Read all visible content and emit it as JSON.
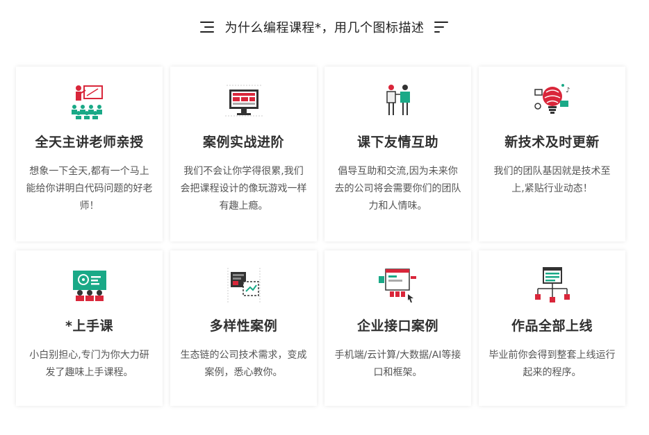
{
  "header": {
    "title": "为什么编程课程*，用几个图标描述"
  },
  "colors": {
    "accent_red": "#d9263a",
    "accent_teal": "#1aa987",
    "dark": "#333333"
  },
  "cards": [
    {
      "icon": "teacher-presentation-icon",
      "title": "全天主讲老师亲授",
      "desc": "想象一下全天,都有一个马上能给你讲明白代码问题的好老师！"
    },
    {
      "icon": "monitor-project-icon",
      "title": "案例实战进阶",
      "desc": "我们不会让你学得很累,我们会把课程设计的像玩游戏一样有趣上瘾。"
    },
    {
      "icon": "people-talking-icon",
      "title": "课下友情互助",
      "desc": "倡导互助和交流,因为未来你去的公司将会需要你们的团队力和人情味。"
    },
    {
      "icon": "brain-tech-icon",
      "title": "新技术及时更新",
      "desc": "我们的团队基因就是技术至上,紧贴行业动态！"
    },
    {
      "icon": "classroom-board-icon",
      "title": "*上手课",
      "desc": "小白别担心,专门为你大力研发了趣味上手课程。"
    },
    {
      "icon": "ecosystem-chart-icon",
      "title": "多样性案例",
      "desc": "生态链的公司技术需求，变成案例，悉心教你。"
    },
    {
      "icon": "api-interface-icon",
      "title": "企业接口案例",
      "desc": "手机端/云计算/大数据/AI等接口和框架。"
    },
    {
      "icon": "deploy-network-icon",
      "title": "作品全部上线",
      "desc": "毕业前你会得到整套上线运行起来的程序。"
    }
  ]
}
